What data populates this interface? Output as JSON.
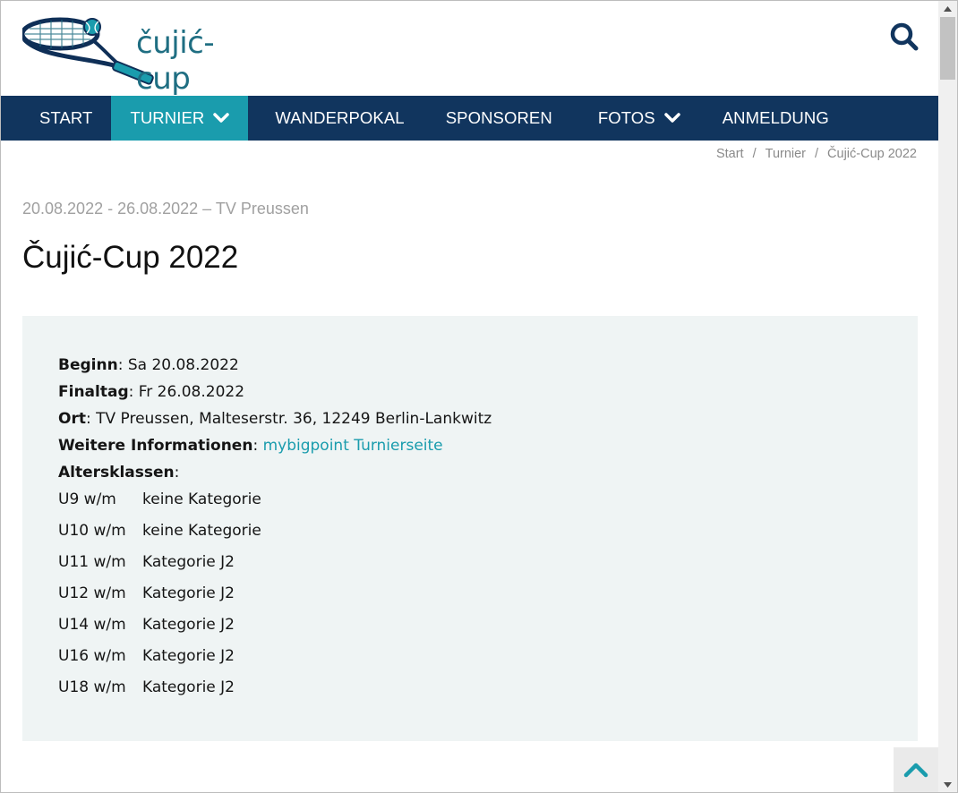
{
  "logo": {
    "text": "čujić-cup"
  },
  "nav": {
    "items": [
      {
        "label": "START",
        "active": false,
        "dropdown": false
      },
      {
        "label": "TURNIER",
        "active": true,
        "dropdown": true
      },
      {
        "label": "WANDERPOKAL",
        "active": false,
        "dropdown": false
      },
      {
        "label": "SPONSOREN",
        "active": false,
        "dropdown": false
      },
      {
        "label": "FOTOS",
        "active": false,
        "dropdown": true
      },
      {
        "label": "ANMELDUNG",
        "active": false,
        "dropdown": false
      }
    ]
  },
  "breadcrumb": {
    "items": [
      "Start",
      "Turnier",
      "Čujić-Cup 2022"
    ],
    "separator": "/"
  },
  "event": {
    "meta": "20.08.2022 - 26.08.2022 – TV Preussen",
    "title": "Čujić-Cup 2022"
  },
  "info": {
    "beginn_label": "Beginn",
    "beginn_value": ": Sa 20.08.2022",
    "finaltag_label": "Finaltag",
    "finaltag_value": ": Fr 26.08.2022",
    "ort_label": "Ort",
    "ort_value": ": TV Preussen, Malteserstr. 36, 12249 Berlin-Lankwitz",
    "weitere_label": "Weitere Informationen",
    "weitere_sep": ": ",
    "weitere_link": "mybigpoint Turnierseite",
    "altersklassen_label": "Altersklassen",
    "altersklassen_sep": ":",
    "age_classes": [
      {
        "class": "U9 w/m",
        "category": "keine Kategorie"
      },
      {
        "class": "U10 w/m",
        "category": "keine Kategorie"
      },
      {
        "class": "U11 w/m",
        "category": "Kategorie J2"
      },
      {
        "class": "U12 w/m",
        "category": "Kategorie J2"
      },
      {
        "class": "U14 w/m",
        "category": "Kategorie J2"
      },
      {
        "class": "U16 w/m",
        "category": "Kategorie J2"
      },
      {
        "class": "U18 w/m",
        "category": "Kategorie J2"
      }
    ]
  },
  "colors": {
    "nav_bg": "#11355e",
    "nav_active": "#1a9cad",
    "link": "#1a9cad",
    "box_bg": "#eff4f4"
  },
  "icons": {
    "search": "search-icon",
    "chevron": "chevron-down-icon",
    "to_top": "chevron-up-icon"
  }
}
